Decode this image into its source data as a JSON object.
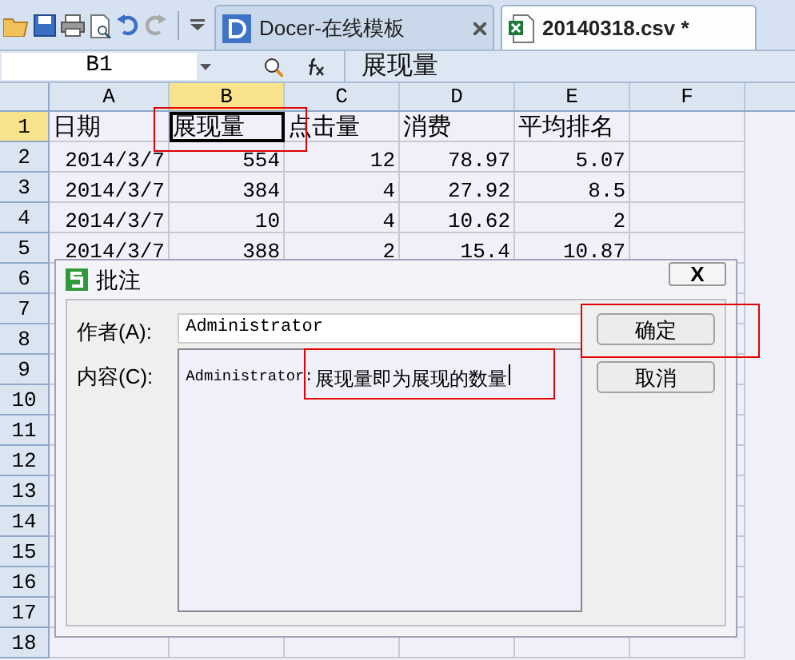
{
  "toolbar": {
    "tabs": [
      {
        "label": "Docer-在线模板",
        "selected": false,
        "kind": "docer"
      },
      {
        "label": "20140318.csv *",
        "selected": true,
        "kind": "sheet"
      }
    ]
  },
  "formula_bar": {
    "name_box": "B1",
    "content": "展现量"
  },
  "sheet": {
    "columns": [
      {
        "label": "A",
        "selected": false
      },
      {
        "label": "B",
        "selected": true
      },
      {
        "label": "C",
        "selected": false
      },
      {
        "label": "D",
        "selected": false
      },
      {
        "label": "E",
        "selected": false
      },
      {
        "label": "F",
        "selected": false
      }
    ],
    "rows": [
      {
        "number": "1",
        "selected": true,
        "cells": [
          "日期",
          "展现量",
          "点击量",
          "消费",
          "平均排名"
        ]
      },
      {
        "number": "2",
        "selected": false,
        "cells": [
          "2014/3/7",
          "554",
          "12",
          "78.97",
          "5.07"
        ]
      },
      {
        "number": "3",
        "selected": false,
        "cells": [
          "2014/3/7",
          "384",
          "4",
          "27.92",
          "8.5"
        ]
      },
      {
        "number": "4",
        "selected": false,
        "cells": [
          "2014/3/7",
          "10",
          "4",
          "10.62",
          "2"
        ]
      },
      {
        "number": "5",
        "selected": false,
        "cells": [
          "2014/3/7",
          "388",
          "2",
          "15.4",
          "10.87"
        ]
      },
      {
        "number": "6",
        "selected": false
      },
      {
        "number": "7",
        "selected": false
      },
      {
        "number": "8",
        "selected": false
      },
      {
        "number": "9",
        "selected": false
      },
      {
        "number": "10",
        "selected": false
      },
      {
        "number": "11",
        "selected": false
      },
      {
        "number": "12",
        "selected": false
      },
      {
        "number": "13",
        "selected": false
      },
      {
        "number": "14",
        "selected": false
      },
      {
        "number": "15",
        "selected": false
      },
      {
        "number": "16",
        "selected": false
      },
      {
        "number": "17",
        "selected": false
      },
      {
        "number": "18",
        "selected": false
      }
    ]
  },
  "dialog": {
    "title": "批注",
    "close": "X",
    "author_label": "作者(A):",
    "author": "Administrator",
    "content_label": "内容(C):",
    "content_author": "Administrator:",
    "content": "展现量即为展现的数量",
    "buttons": [
      "确定",
      "取消"
    ]
  }
}
